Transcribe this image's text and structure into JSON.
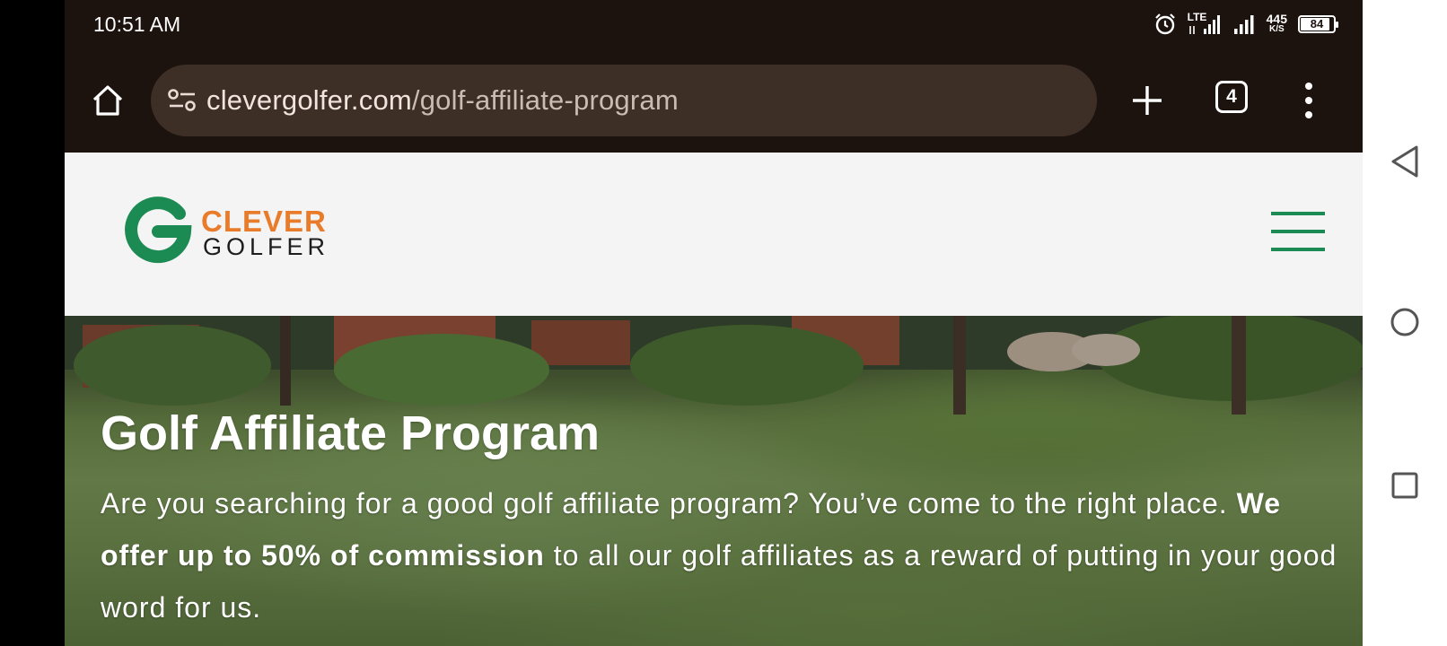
{
  "status_bar": {
    "time": "10:51 AM",
    "network": "LTE",
    "speed_value": "445",
    "speed_unit": "K/S",
    "battery": "84"
  },
  "browser": {
    "url_domain": "clevergolfer.com",
    "url_path": "/golf-affiliate-program",
    "tab_count": "4"
  },
  "site": {
    "logo_line1": "CLEVER",
    "logo_line2": "GOLFER",
    "brand_green": "#1b8a53",
    "brand_orange": "#e87c2b"
  },
  "hero": {
    "title": "Golf Affiliate Program",
    "body_start": "Are you searching for a good golf affiliate program? You’ve come to the right place. ",
    "body_bold": "We offer up to 50% of commission",
    "body_end": " to all our golf affiliates as a reward of putting in your good word for us."
  },
  "icons": {
    "home": "home-icon",
    "site_info": "site-settings-icon",
    "new_tab": "plus-icon",
    "tabs": "tab-switcher-icon",
    "menu": "more-vert-icon",
    "hamburger": "hamburger-menu-icon",
    "nav_back": "back-triangle-icon",
    "nav_home": "home-circle-icon",
    "nav_recents": "recents-square-icon"
  }
}
